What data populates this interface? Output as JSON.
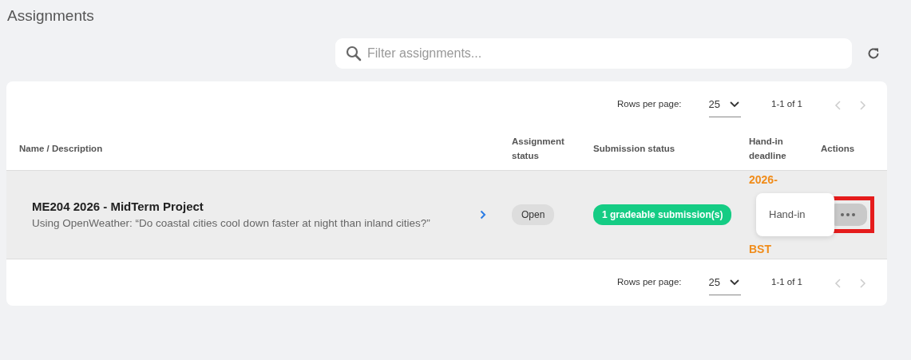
{
  "page_title": "Assignments",
  "search": {
    "placeholder": "Filter assignments..."
  },
  "pagination_top": {
    "rows_label": "Rows per page:",
    "rows_value": "25",
    "range": "1-1 of 1",
    "prev_disabled": true,
    "next_disabled": true
  },
  "table": {
    "columns": [
      "Name / Description",
      "Assignment status",
      "Submission status",
      "Hand-in deadline",
      "Actions"
    ],
    "rows": [
      {
        "name": "ME204 2026 - MidTerm Project",
        "description": "Using OpenWeather: “Do coastal cities cool down faster at night than inland cities?”",
        "assignment_status": "Open",
        "submission_status": "1 gradeable submission(s)",
        "deadline_lines": [
          "2026-",
          "BST"
        ],
        "actions_highlighted": true
      }
    ]
  },
  "actions_menu": {
    "items": [
      "Hand-in"
    ]
  },
  "pagination_bottom": {
    "rows_label": "Rows per page:",
    "rows_value": "25",
    "range": "1-1 of 1",
    "prev_disabled": true,
    "next_disabled": true
  }
}
